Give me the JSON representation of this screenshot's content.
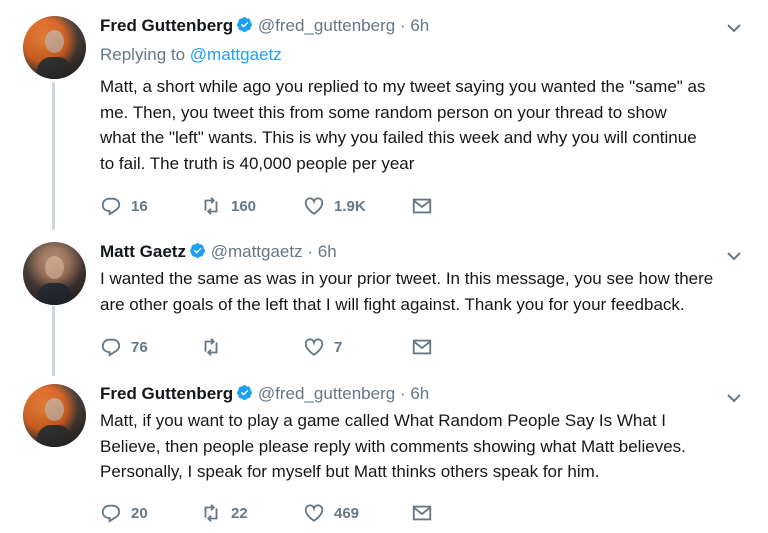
{
  "colors": {
    "accent": "#1da1f2",
    "muted": "#657786",
    "text": "#14171a",
    "thread_line": "#ccd6dd"
  },
  "tweets": [
    {
      "author": "Fred Guttenberg",
      "handle": "@fred_guttenberg",
      "separator": "·",
      "time": "6h",
      "verified": true,
      "avatar": "avatar-fred-guttenberg",
      "reply_prefix": "Replying to",
      "reply_to": "@mattgaetz",
      "lines": [
        "Matt, a short while ago you replied to my tweet saying you wanted the \"same\" as",
        "me.  Then, you tweet this from some random person on your thread to show",
        "what the \"left\" wants.  This is why you failed this week and why you will continue",
        "to fail. The truth is 40,000 people per year"
      ],
      "replies": "16",
      "retweets": "160",
      "likes": "1.9K"
    },
    {
      "author": "Matt Gaetz",
      "handle": "@mattgaetz",
      "separator": "·",
      "time": "6h",
      "verified": true,
      "avatar": "avatar-matt-gaetz",
      "lines": [
        "I wanted the same as was in your prior tweet. In this message, you see how there",
        "are other goals of the left that I will fight against. Thank you for your feedback."
      ],
      "replies": "76",
      "retweets": "",
      "likes": "7"
    },
    {
      "author": "Fred Guttenberg",
      "handle": "@fred_guttenberg",
      "separator": "·",
      "time": "6h",
      "verified": true,
      "avatar": "avatar-fred-guttenberg",
      "lines": [
        "Matt, if you want to play a game called What Random People Say Is What I",
        "Believe, then people please reply with comments showing what Matt believes.",
        "Personally, I speak for myself but Matt thinks others speak for him."
      ],
      "replies": "20",
      "retweets": "22",
      "likes": "469"
    }
  ],
  "icons": [
    "verified-badge-icon",
    "chevron-down-icon",
    "reply-icon",
    "retweet-icon",
    "like-icon",
    "direct-message-icon"
  ]
}
